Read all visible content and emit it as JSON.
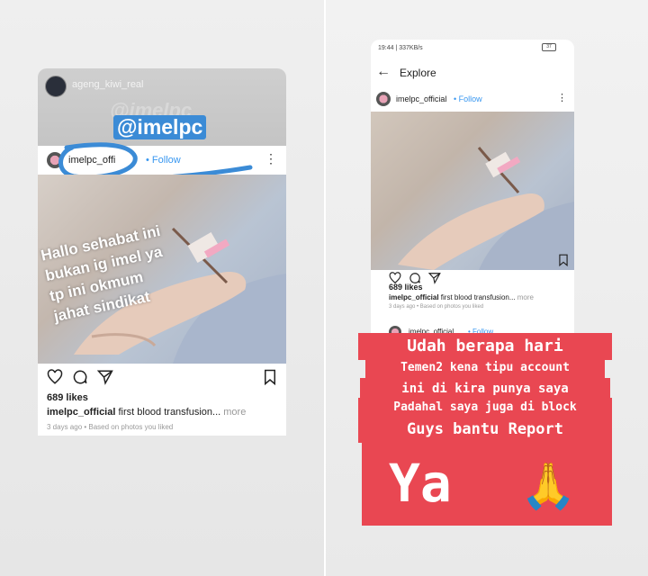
{
  "left_story": {
    "username": "ageng_kiwi_real",
    "ghost_mention": "@imelpc",
    "mention": "@imelpc",
    "post": {
      "username": "imelpc_offi",
      "follow": "• Follow",
      "overlay_lines": [
        "Hallo sehabat ini",
        "bukan ig imel ya",
        "tp ini okmum",
        "jahat sindikat"
      ],
      "likes": "689 likes",
      "caption_user": "imelpc_official",
      "caption_text": " first blood transfusion... ",
      "caption_more": "more",
      "meta": "3 days ago • Based on photos you liked"
    }
  },
  "right_story": {
    "status_time": "19:44 | 337KB/s",
    "battery": "37",
    "screen_title": "Explore",
    "post": {
      "username": "imelpc_official",
      "follow": "• Follow",
      "likes": "689 likes",
      "caption_user": "imelpc_official",
      "caption_text": " first blood transfusion... ",
      "caption_more": "more",
      "meta": "3 days ago • Based on photos you liked"
    },
    "next_post": {
      "username": "imelpc_official",
      "follow": "• Follow"
    },
    "sticker_lines": [
      "Udah berapa hari",
      "Temen2 kena tipu account",
      "ini di kira punya saya",
      "Padahal saya juga di block",
      "Guys bantu Report"
    ],
    "big_text": "Ya",
    "emoji": "🙏"
  },
  "colors": {
    "follow_blue": "#3897f0",
    "sticker_red": "#e94752",
    "scribble_blue": "#3b8bd6"
  }
}
